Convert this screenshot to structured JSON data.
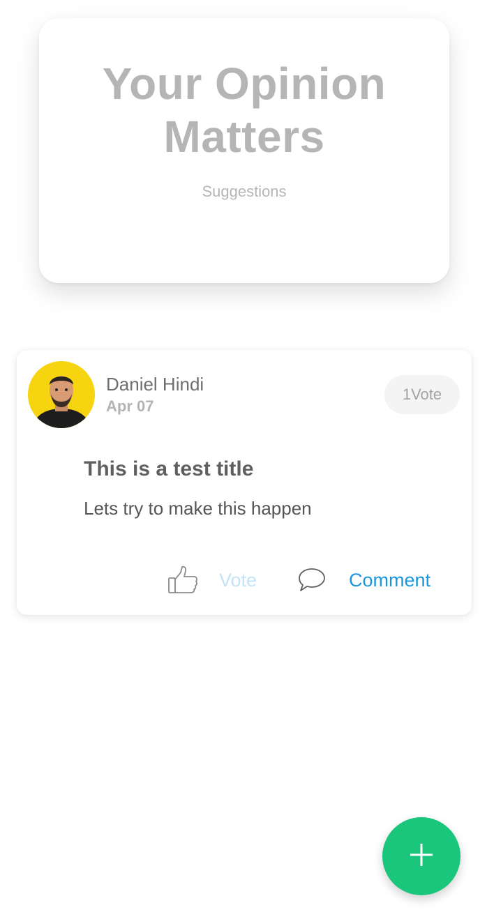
{
  "header": {
    "title": "Your Opinion Matters",
    "subtitle": "Suggestions"
  },
  "post": {
    "author": "Daniel Hindi",
    "date": "Apr 07",
    "vote_count": "1",
    "vote_count_label": "Vote",
    "title": "This is a test title",
    "body": "Lets try to make this happen",
    "actions": {
      "vote_label": "Vote",
      "comment_label": "Comment"
    }
  },
  "icons": {
    "vote": "thumbs-up-icon",
    "comment": "speech-bubble-icon",
    "add": "plus-icon"
  },
  "colors": {
    "accent_green": "#19c67b",
    "comment_blue": "#1b96dc",
    "vote_light_blue": "#c3e3f6",
    "avatar_bg": "#f6d40f"
  }
}
